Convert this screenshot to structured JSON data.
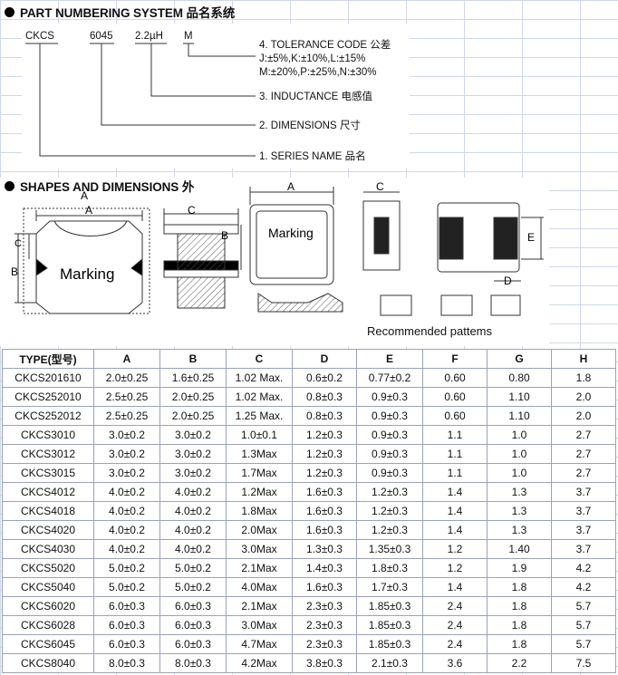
{
  "section1": {
    "title": "PART NUMBERING SYSTEM 品名系统"
  },
  "part_code": {
    "series": "CKCS",
    "dimensions": "6045",
    "inductance": "2.2µH",
    "tolerance": "M"
  },
  "labels": {
    "tolerance_title": "4. TOLERANCE CODE 公差",
    "tolerance_line1": "J:±5%,K:±10%,L:±15%",
    "tolerance_line2": "M:±20%,P:±25%,N:±30%",
    "inductance": "3. INDUCTANCE 电感值",
    "dimensions": "2. DIMENSIONS 尺寸",
    "series": "1. SERIES NAME 品名"
  },
  "section2": {
    "title": "SHAPES AND DIMENSIONS 外"
  },
  "drawing": {
    "dim_a": "A",
    "dim_b": "B",
    "dim_c": "C",
    "dim_d": "D",
    "dim_e": "E",
    "marking": "Marking",
    "marking_top": "Marking",
    "recommended": "Recommended pattems"
  },
  "table": {
    "headers": [
      "TYPE(型号)",
      "A",
      "B",
      "C",
      "D",
      "E",
      "F",
      "G",
      "H"
    ],
    "rows": [
      [
        "CKCS201610",
        "2.0±0.25",
        "1.6±0.25",
        "1.02 Max.",
        "0.6±0.2",
        "0.77±0.2",
        "0.60",
        "0.80",
        "1.8"
      ],
      [
        "CKCS252010",
        "2.5±0.25",
        "2.0±0.25",
        "1.02 Max.",
        "0.8±0.3",
        "0.9±0.3",
        "0.60",
        "1.10",
        "2.0"
      ],
      [
        "CKCS252012",
        "2.5±0.25",
        "2.0±0.25",
        "1.25 Max.",
        "0.8±0.3",
        "0.9±0.3",
        "0.60",
        "1.10",
        "2.0"
      ],
      [
        "CKCS3010",
        "3.0±0.2",
        "3.0±0.2",
        "1.0±0.1",
        "1.2±0.3",
        "0.9±0.3",
        "1.1",
        "1.0",
        "2.7"
      ],
      [
        "CKCS3012",
        "3.0±0.2",
        "3.0±0.2",
        "1.3Max",
        "1.2±0.3",
        "0.9±0.3",
        "1.1",
        "1.0",
        "2.7"
      ],
      [
        "CKCS3015",
        "3.0±0.2",
        "3.0±0.2",
        "1.7Max",
        "1.2±0.3",
        "0.9±0.3",
        "1.1",
        "1.0",
        "2.7"
      ],
      [
        "CKCS4012",
        "4.0±0.2",
        "4.0±0.2",
        "1.2Max",
        "1.6±0.3",
        "1.2±0.3",
        "1.4",
        "1.3",
        "3.7"
      ],
      [
        "CKCS4018",
        "4.0±0.2",
        "4.0±0.2",
        "1.8Max",
        "1.6±0.3",
        "1.2±0.3",
        "1.4",
        "1.3",
        "3.7"
      ],
      [
        "CKCS4020",
        "4.0±0.2",
        "4.0±0.2",
        "2.0Max",
        "1.6±0.3",
        "1.2±0.3",
        "1.4",
        "1.3",
        "3.7"
      ],
      [
        "CKCS4030",
        "4.0±0.2",
        "4.0±0.2",
        "3.0Max",
        "1.3±0.3",
        "1.35±0.3",
        "1.2",
        "1.40",
        "3.7"
      ],
      [
        "CKCS5020",
        "5.0±0.2",
        "5.0±0.2",
        "2.1Max",
        "1.4±0.3",
        "1.8±0.3",
        "1.2",
        "1.9",
        "4.2"
      ],
      [
        "CKCS5040",
        "5.0±0.2",
        "5.0±0.2",
        "4.0Max",
        "1.6±0.3",
        "1.7±0.3",
        "1.4",
        "1.8",
        "4.2"
      ],
      [
        "CKCS6020",
        "6.0±0.3",
        "6.0±0.3",
        "2.1Max",
        "2.3±0.3",
        "1.85±0.3",
        "2.4",
        "1.8",
        "5.7"
      ],
      [
        "CKCS6028",
        "6.0±0.3",
        "6.0±0.3",
        "3.0Max",
        "2.3±0.3",
        "1.85±0.3",
        "2.4",
        "1.8",
        "5.7"
      ],
      [
        "CKCS6045",
        "6.0±0.3",
        "6.0±0.3",
        "4.7Max",
        "2.3±0.3",
        "1.85±0.3",
        "2.4",
        "1.8",
        "5.7"
      ],
      [
        "CKCS8040",
        "8.0±0.3",
        "8.0±0.3",
        "4.2Max",
        "3.8±0.3",
        "2.1±0.3",
        "3.6",
        "2.2",
        "7.5"
      ]
    ]
  }
}
